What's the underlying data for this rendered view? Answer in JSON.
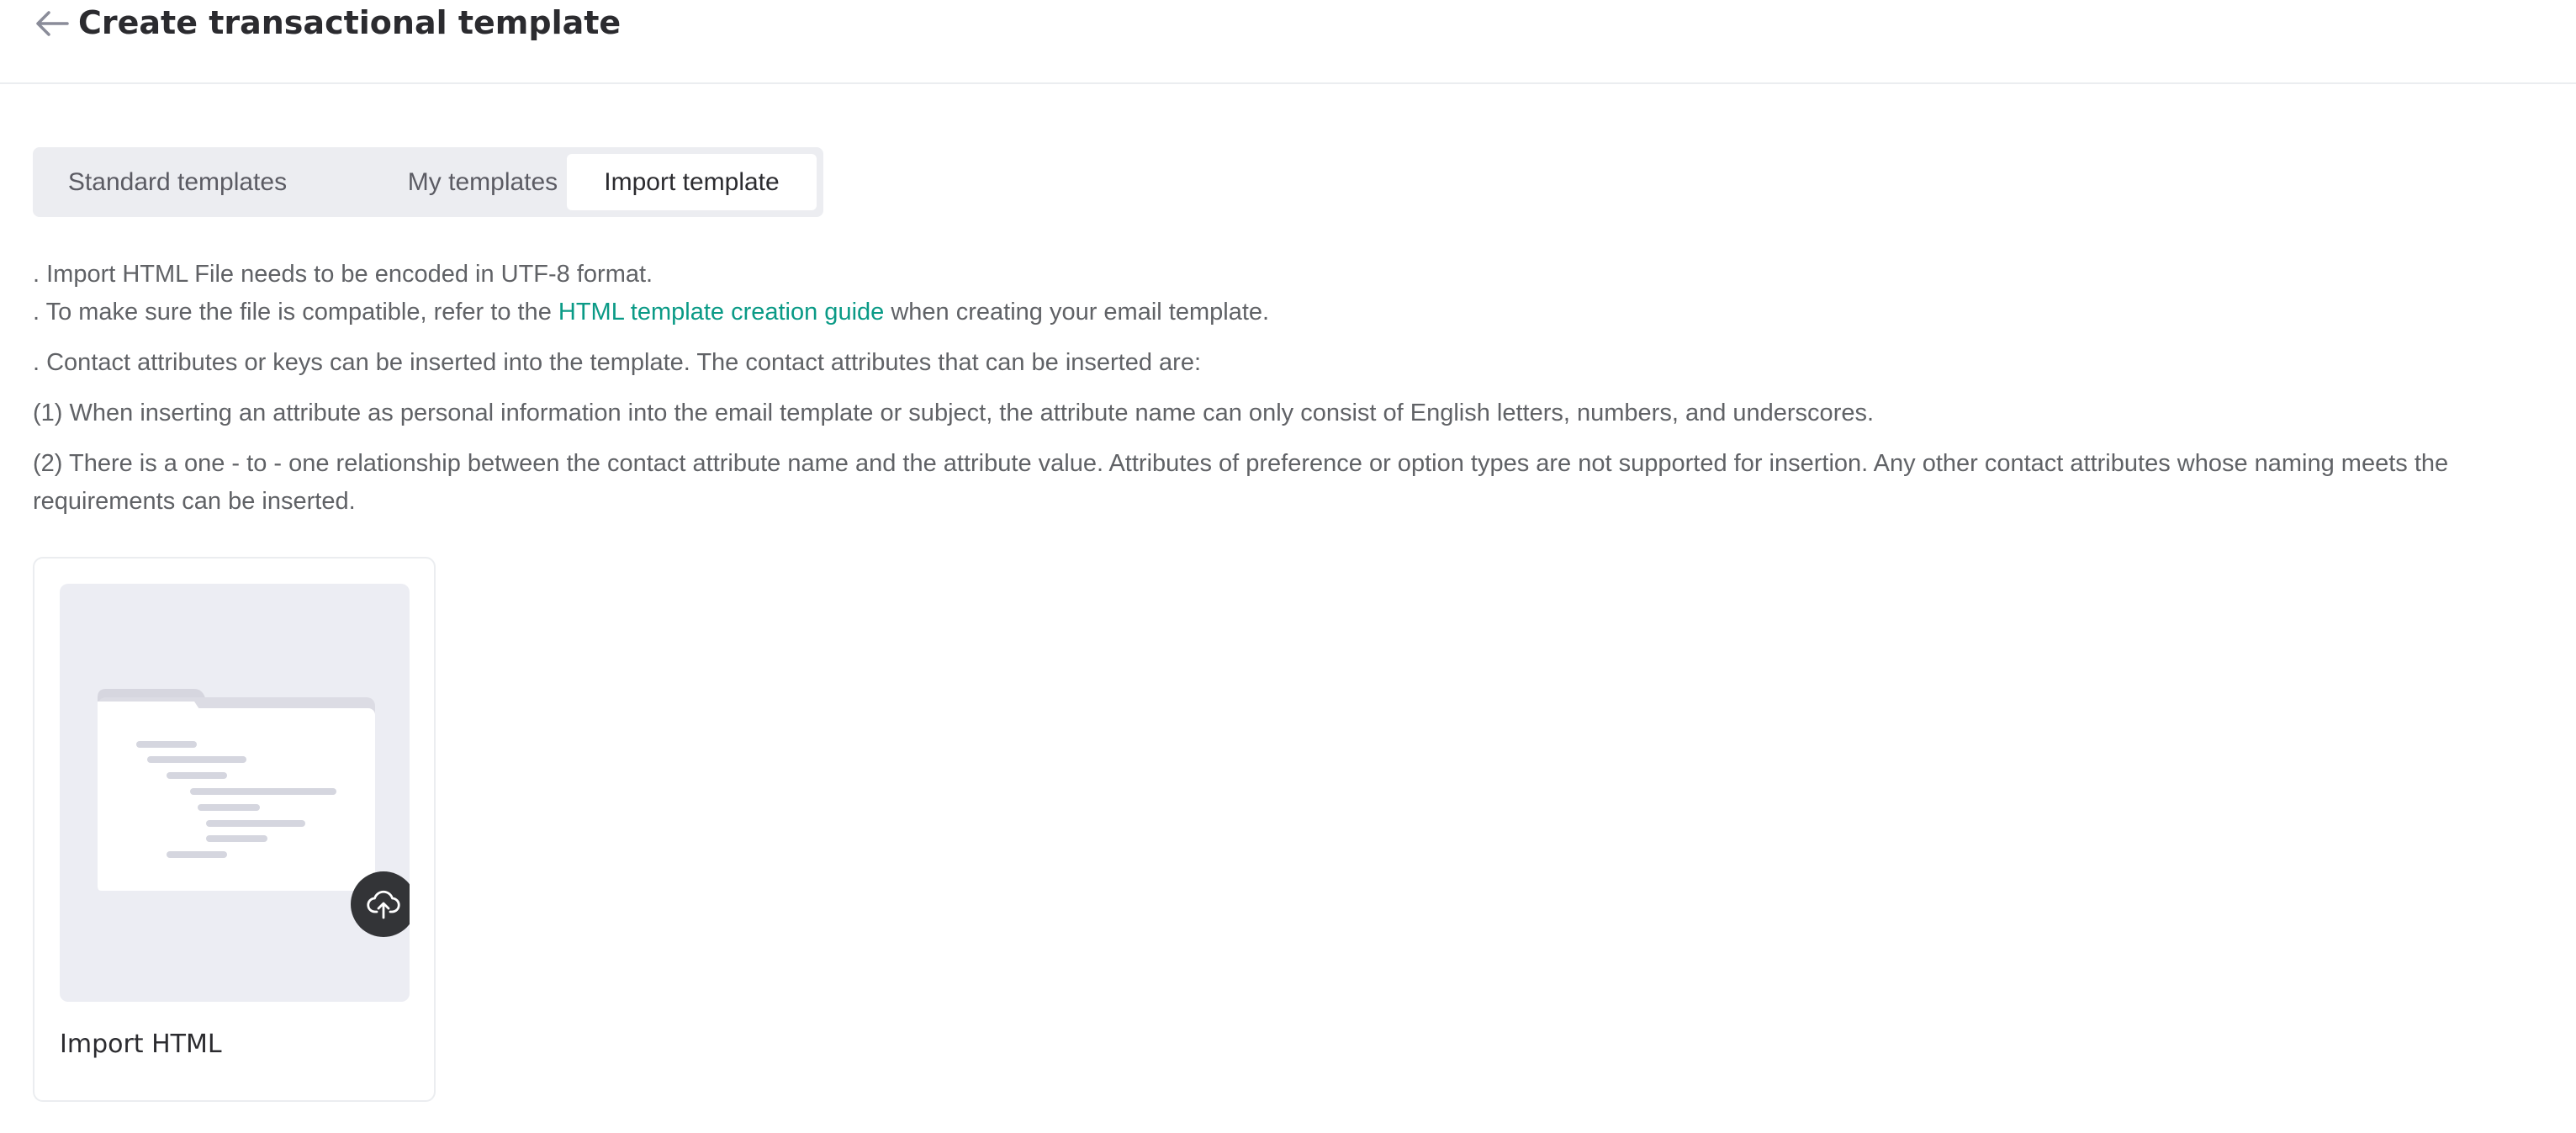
{
  "header": {
    "back_icon": "arrow-left-icon",
    "title": "Create transactional template"
  },
  "tabs": [
    {
      "label": "Standard templates",
      "active": false
    },
    {
      "label": "My templates",
      "active": false
    },
    {
      "label": "Import template",
      "active": true
    }
  ],
  "notes": {
    "line1": ". Import HTML File needs to be encoded in UTF-8 format.",
    "line2_prefix": ". To make sure the file is compatible, refer to the ",
    "line2_link": "HTML template creation guide",
    "line2_suffix": " when creating your email template.",
    "line3": ". Contact attributes or keys can be inserted into the template. The contact attributes that can be inserted are:",
    "line4": "(1) When inserting an attribute as personal information into the email template or subject, the attribute name can only consist of English letters, numbers, and underscores.",
    "line5": "(2) There is a one - to - one relationship between the contact attribute name and the attribute value. Attributes of preference or option types are not supported for insertion. Any other contact attributes whose naming meets the requirements can be inserted."
  },
  "import_card": {
    "label": "Import HTML",
    "illustration_icon": "folder-document-icon",
    "upload_icon": "cloud-upload-icon"
  },
  "colors": {
    "link": "#0a9a86",
    "tab_bar_bg": "#ecedf1",
    "active_tab_bg": "#ffffff",
    "preview_bg": "#ecedf3",
    "upload_button_bg": "#333437"
  }
}
